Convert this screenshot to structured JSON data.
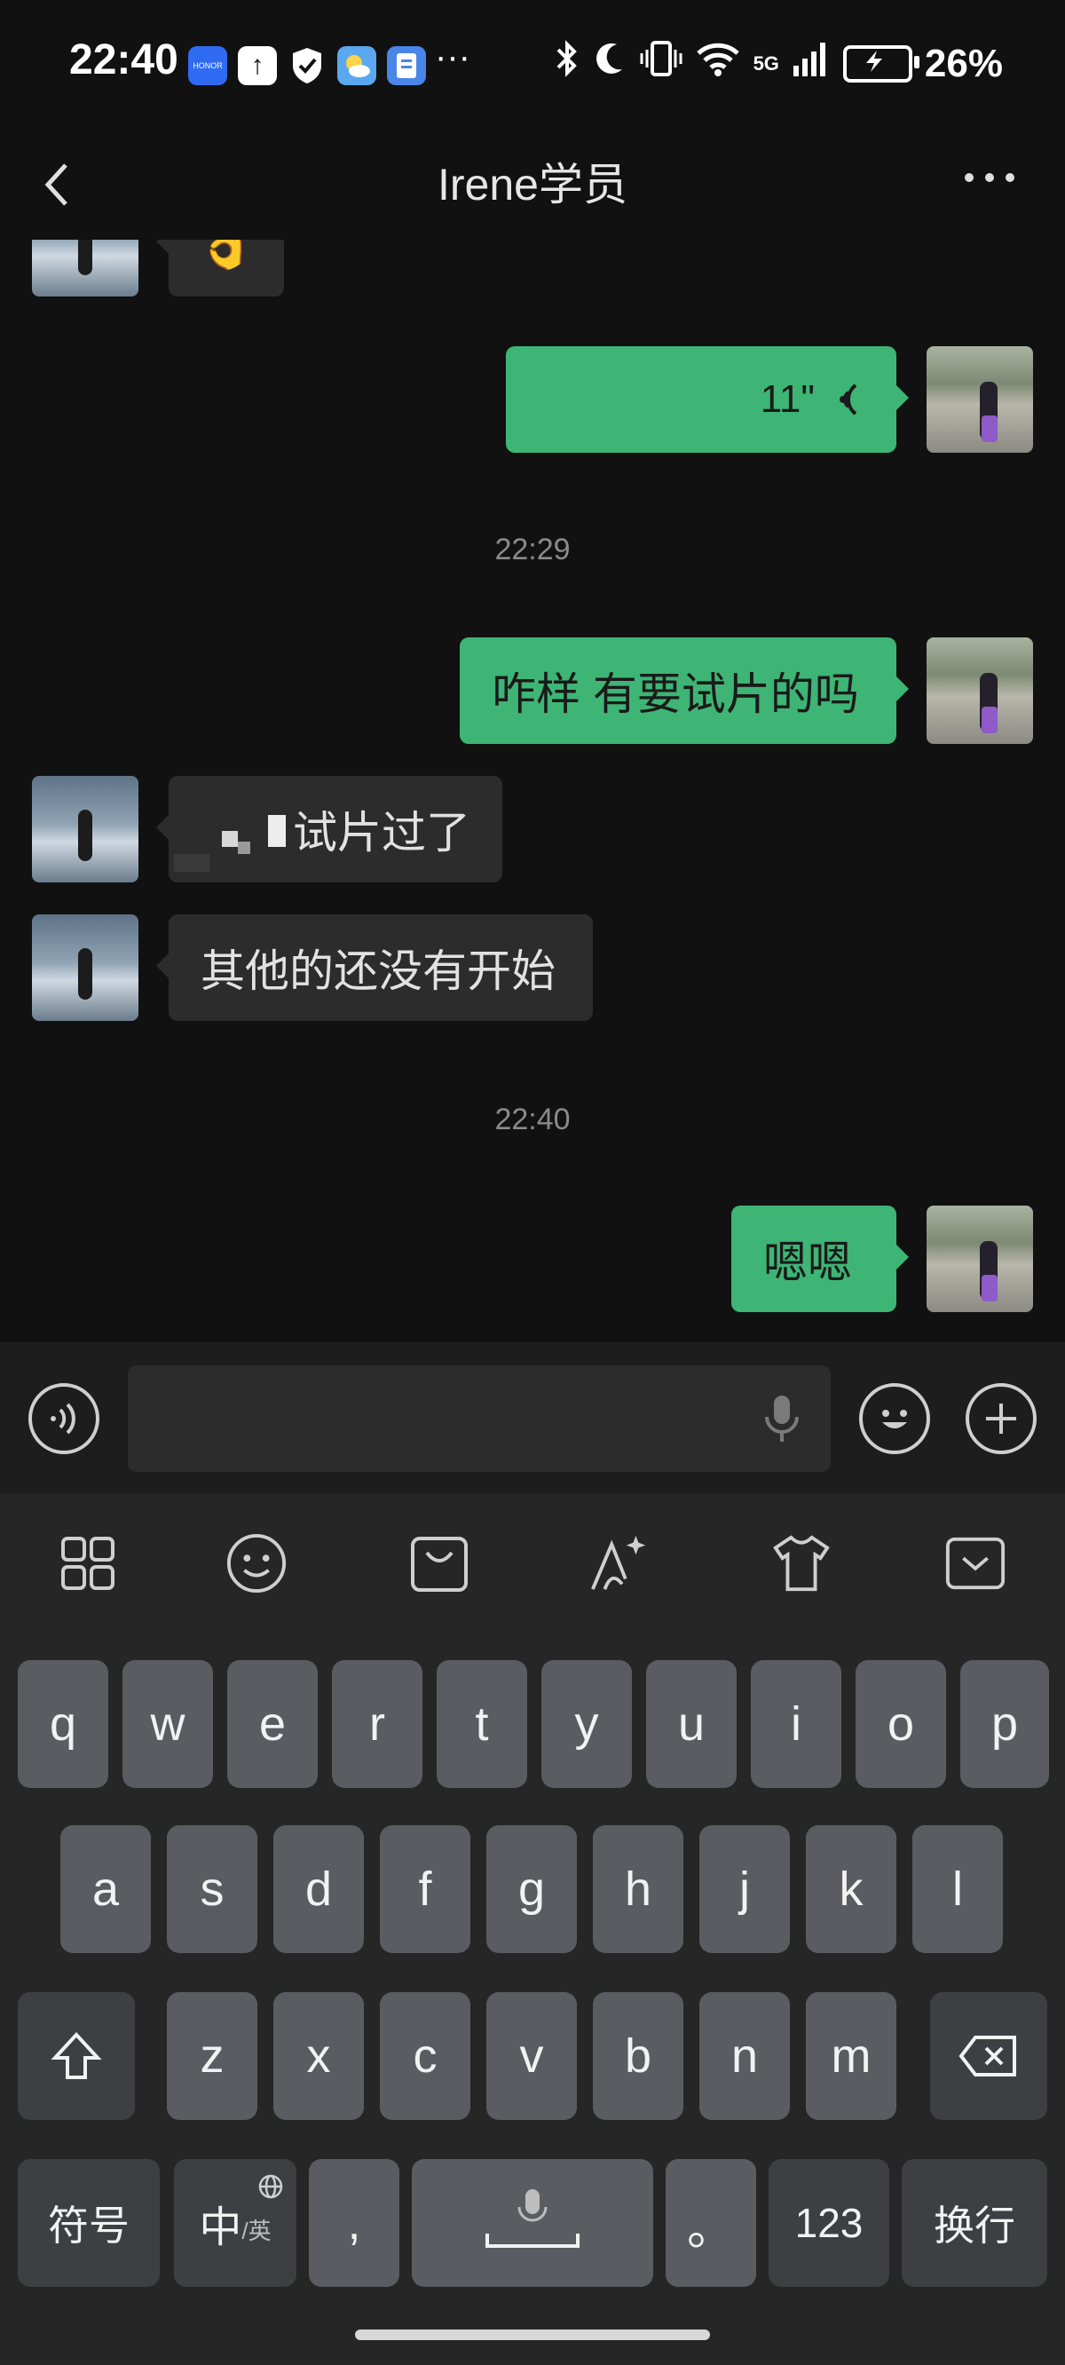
{
  "status_bar": {
    "time": "22:40",
    "app_icons": [
      "honor-app-icon",
      "upload-icon",
      "shield-icon",
      "weather-icon",
      "memo-icon"
    ],
    "app_honor_label": "HONOR",
    "more": "···",
    "network": "5G",
    "battery": "26%"
  },
  "nav": {
    "title": "Irene学员"
  },
  "messages": [
    {
      "side": "in",
      "type": "emoji",
      "text": "👌"
    },
    {
      "side": "out",
      "type": "voice",
      "text": "11\""
    },
    {
      "side": "time",
      "text": "22:29"
    },
    {
      "side": "out",
      "type": "text",
      "text": "咋样 有要试片的吗"
    },
    {
      "side": "in",
      "type": "text",
      "text": "试片过了"
    },
    {
      "side": "in",
      "type": "text",
      "text": "其他的还没有开始"
    },
    {
      "side": "time",
      "text": "22:40"
    },
    {
      "side": "out",
      "type": "text",
      "text": "嗯嗯"
    }
  ],
  "input": {
    "placeholder": ""
  },
  "keyboard": {
    "row1": [
      "q",
      "w",
      "e",
      "r",
      "t",
      "y",
      "u",
      "i",
      "o",
      "p"
    ],
    "row2": [
      "a",
      "s",
      "d",
      "f",
      "g",
      "h",
      "j",
      "k",
      "l"
    ],
    "row3": [
      "z",
      "x",
      "c",
      "v",
      "b",
      "n",
      "m"
    ],
    "symbols": "符号",
    "lang_main": "中",
    "lang_sub": "/英",
    "comma": ",",
    "period": "。",
    "numbers": "123",
    "enter": "换行"
  },
  "colors": {
    "outgoing": "#3eb575",
    "incoming": "#2c2c2c",
    "background": "#111111"
  }
}
